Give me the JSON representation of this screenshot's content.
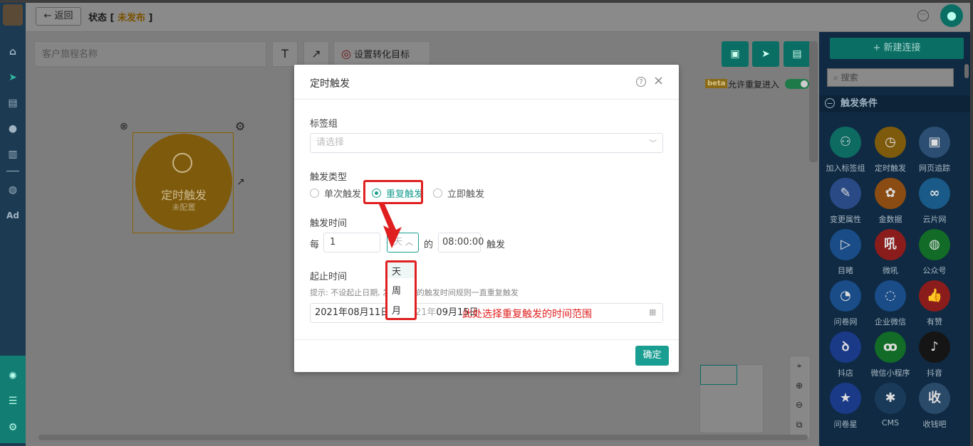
{
  "topbar": {
    "back_label": "← 返回",
    "status_prefix": "状态 [ ",
    "status_value": "未发布",
    "status_suffix": " ]"
  },
  "toolbar": {
    "journey_placeholder": "客户旅程名称",
    "text_tool": "T",
    "arrow_tool": "↗",
    "set_goal_label": "设置转化目标",
    "beta_badge": "beta",
    "allow_repeat_label": "允许重复进入"
  },
  "canvas_node": {
    "title": "定时触发",
    "subtitle": "未配置"
  },
  "right_panel": {
    "new_connection_label": "+ 新建连接",
    "search_placeholder": "搜索",
    "section_title": "触发条件",
    "items": [
      {
        "label": "加入标签组",
        "icon": "user-add-icon",
        "color": "#0e6b62",
        "glyph": "⚇"
      },
      {
        "label": "定时触发",
        "icon": "clock-icon",
        "color": "#7e5a0c",
        "glyph": "◷"
      },
      {
        "label": "网页追踪",
        "icon": "webpage-icon",
        "color": "#2c4e73",
        "glyph": "▣"
      },
      {
        "label": "变更属性",
        "icon": "edit-icon",
        "color": "#2a4a86",
        "glyph": "✎"
      },
      {
        "label": "金数据",
        "icon": "jinshuju-icon",
        "color": "#8a4c12",
        "glyph": "✿"
      },
      {
        "label": "云片网",
        "icon": "yunpian-icon",
        "color": "#1a5a88",
        "glyph": "∞"
      },
      {
        "label": "目睹",
        "icon": "play-icon",
        "color": "#1a4c88",
        "glyph": "▷"
      },
      {
        "label": "微吼",
        "icon": "weihou-icon",
        "color": "#8a1c1c",
        "glyph": "吼"
      },
      {
        "label": "公众号",
        "icon": "wechat-icon",
        "color": "#126b26",
        "glyph": "◍"
      },
      {
        "label": "问卷网",
        "icon": "wenjuan-icon",
        "color": "#1a4c88",
        "glyph": "◔"
      },
      {
        "label": "企业微信",
        "icon": "wecom-icon",
        "color": "#1a4c88",
        "glyph": "◌"
      },
      {
        "label": "有赞",
        "icon": "youzan-icon",
        "color": "#8a1c1c",
        "glyph": "👍"
      },
      {
        "label": "抖店",
        "icon": "doudian-icon",
        "color": "#1a3a88",
        "glyph": "ꝺ"
      },
      {
        "label": "微信小程序",
        "icon": "miniprogram-icon",
        "color": "#126b26",
        "glyph": "ꝏ"
      },
      {
        "label": "抖音",
        "icon": "douyin-icon",
        "color": "#151515",
        "glyph": "♪"
      },
      {
        "label": "问卷星",
        "icon": "star-icon",
        "color": "#1a3a88",
        "glyph": "★"
      },
      {
        "label": "CMS",
        "icon": "cms-icon",
        "color": "#1a3a5a",
        "glyph": "✱"
      },
      {
        "label": "收钱吧",
        "icon": "shouqianba-icon",
        "color": "#2a4a6a",
        "glyph": "收"
      }
    ]
  },
  "modal": {
    "title": "定时触发",
    "tag_group_label": "标签组",
    "tag_group_placeholder": "请选择",
    "trigger_type_label": "触发类型",
    "trigger_options": [
      "单次触发",
      "重复触发",
      "立即触发"
    ],
    "selected_trigger": "重复触发",
    "trigger_time_label": "触发时间",
    "every_label": "每",
    "every_value": "1",
    "unit_value": "天",
    "of_label": "的",
    "time_value": "08:00:00",
    "trigger_suffix": "触发",
    "unit_options": [
      "天",
      "周",
      "月"
    ],
    "period_label": "起止时间",
    "period_hint": "提示: 不设起止日期, 发      按上面的触发时间规则一直重复触发",
    "start_date": "2021年08月11日",
    "end_date": "09月15日",
    "annotation": "此处选择重复触发的时间范围",
    "confirm_label": "确定"
  }
}
